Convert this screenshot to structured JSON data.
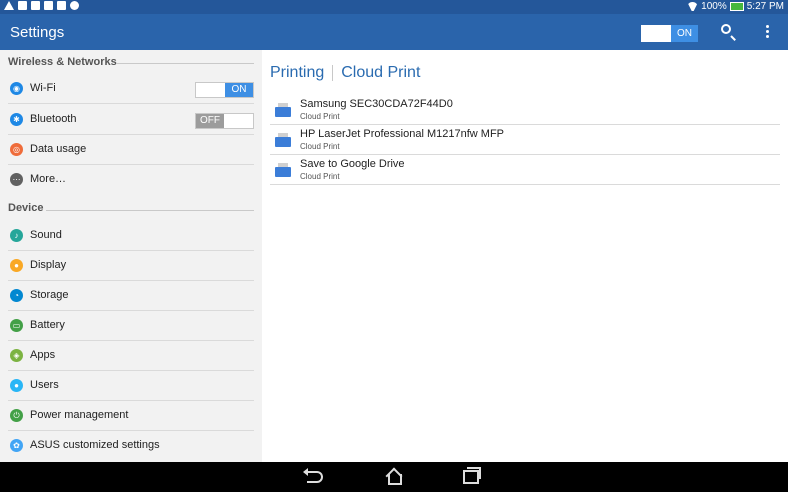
{
  "statusbar": {
    "battery_pct": "100%",
    "time": "5:27 PM"
  },
  "actionbar": {
    "title": "Settings",
    "master_toggle": "ON"
  },
  "sidebar": {
    "sections": [
      {
        "title": "Wireless & Networks"
      },
      {
        "title": "Device"
      }
    ],
    "items": [
      {
        "label": "Wi-Fi",
        "icon": "wifi-icon",
        "color": "#1e88e5",
        "toggle": "ON"
      },
      {
        "label": "Bluetooth",
        "icon": "bluetooth-icon",
        "color": "#1e88e5",
        "toggle": "OFF"
      },
      {
        "label": "Data usage",
        "icon": "data-usage-icon",
        "color": "#ef6c3a"
      },
      {
        "label": "More…",
        "icon": "more-icon",
        "color": "#616161"
      },
      {
        "label": "Sound",
        "icon": "sound-icon",
        "color": "#26a69a"
      },
      {
        "label": "Display",
        "icon": "display-icon",
        "color": "#f9a825"
      },
      {
        "label": "Storage",
        "icon": "storage-icon",
        "color": "#0288d1"
      },
      {
        "label": "Battery",
        "icon": "battery-icon",
        "color": "#43a047"
      },
      {
        "label": "Apps",
        "icon": "apps-icon",
        "color": "#7cb342"
      },
      {
        "label": "Users",
        "icon": "users-icon",
        "color": "#29b6f6"
      },
      {
        "label": "Power management",
        "icon": "power-icon",
        "color": "#43a047"
      },
      {
        "label": "ASUS customized settings",
        "icon": "asus-settings-icon",
        "color": "#42a5f5"
      }
    ]
  },
  "main": {
    "breadcrumb": [
      "Printing",
      "Cloud Print"
    ],
    "printers": [
      {
        "name": "Samsung SEC30CDA72F44D0",
        "sub": "Cloud Print"
      },
      {
        "name": "HP LaserJet Professional M1217nfw MFP",
        "sub": "Cloud Print"
      },
      {
        "name": "Save to Google Drive",
        "sub": "Cloud Print"
      }
    ]
  }
}
